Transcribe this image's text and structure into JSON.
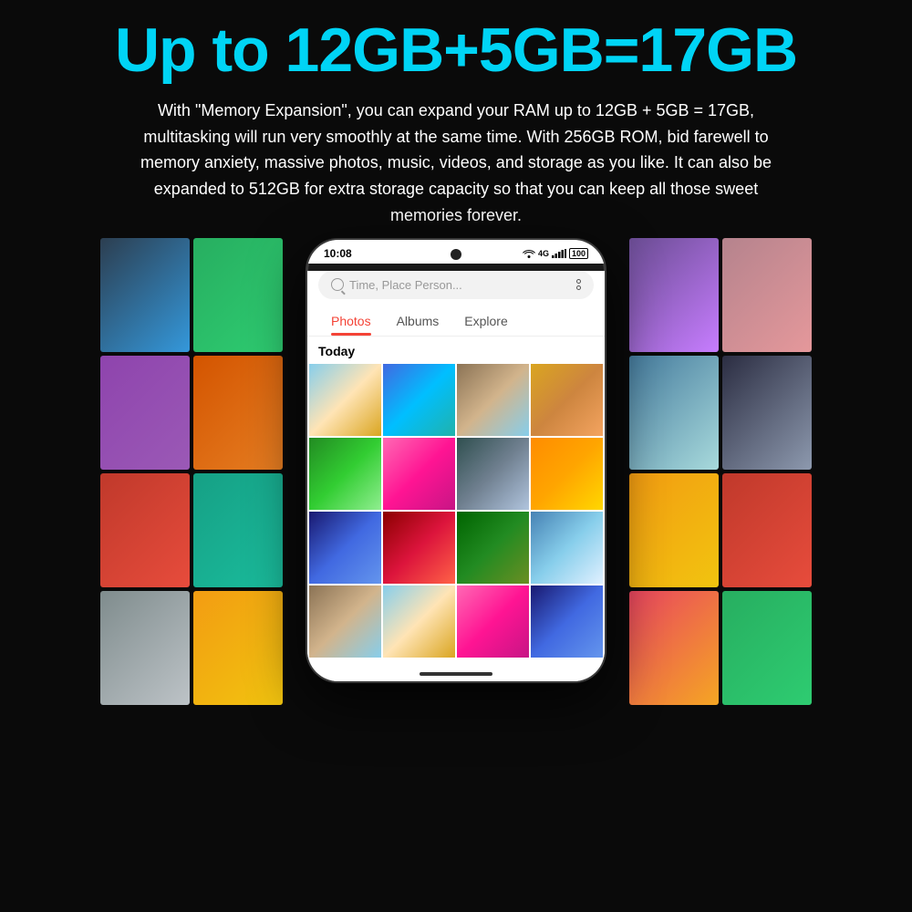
{
  "headline": "Up to 12GB+5GB=17GB",
  "description": "With \"Memory Expansion\", you can expand your RAM up to 12GB + 5GB = 17GB, multitasking will run very smoothly at the same time. With 256GB ROM, bid farewell to memory anxiety, massive photos, music, videos, and storage as you like.  It can also be expanded to 512GB for extra storage capacity so that you can keep all those sweet memories forever.",
  "phone": {
    "status_time": "10:08",
    "status_icons": "📶 📶 4G 100",
    "search_placeholder": "Time,  Place Person...",
    "tabs": [
      "Photos",
      "Albums",
      "Explore"
    ],
    "active_tab": "Photos",
    "today_label": "Today"
  }
}
